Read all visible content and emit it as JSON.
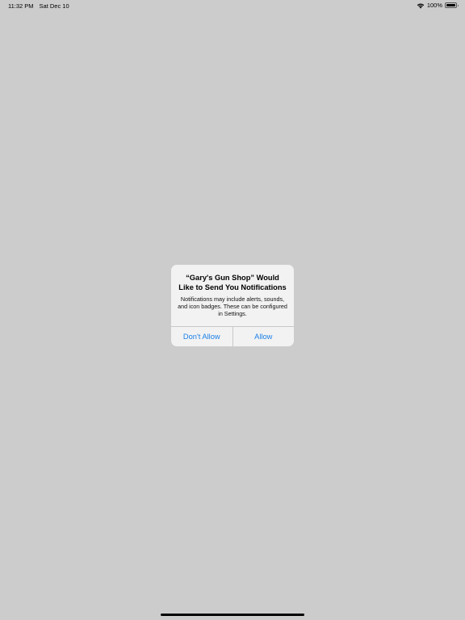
{
  "status_bar": {
    "time": "11:32 PM",
    "date": "Sat Dec 10",
    "battery_percent": "100%",
    "battery_level": 1.0,
    "icons": [
      "wifi-icon",
      "battery-icon"
    ]
  },
  "alert": {
    "title": "“Gary's Gun Shop” Would Like to Send You Notifications",
    "message": "Notifications may include alerts, sounds, and icon badges. These can be configured in Settings.",
    "deny_label": "Don't Allow",
    "allow_label": "Allow",
    "button_color": "#1a7fe8"
  },
  "colors": {
    "background": "#cccccc",
    "alert_background": "#f2f2f2"
  }
}
